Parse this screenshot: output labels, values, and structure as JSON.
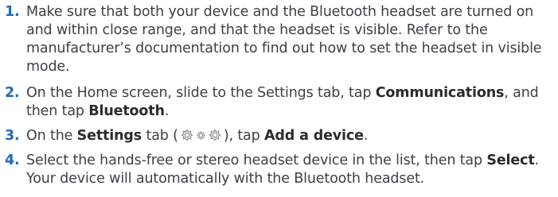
{
  "steps": [
    {
      "number": "1.",
      "text": "Make sure that both your device and the Bluetooth headset are turned on and within close range, and that the headset is visible. Refer to the manufacturer’s documentation to find out how to set the headset in visible mode."
    },
    {
      "number": "2.",
      "text_a": "On the Home screen, slide to the Settings tab, tap ",
      "bold_a": "Communications",
      "text_b": ", and then tap ",
      "bold_b": "Bluetooth",
      "text_c": "."
    },
    {
      "number": "3.",
      "text_a": "On the ",
      "bold_a": "Settings",
      "text_b": " tab (",
      "icon": "settings-gears-icon",
      "text_c": "), tap ",
      "bold_b": "Add a device",
      "text_d": "."
    },
    {
      "number": "4.",
      "text_a": "Select the hands-free or stereo headset device in the list, then tap ",
      "bold_a": "Select",
      "text_b": ". Your device will automatically with the Bluetooth headset."
    }
  ],
  "colors": {
    "step_number": "#1f69b3",
    "body_text": "#3d4047",
    "icon_stroke": "#8a8d93"
  }
}
